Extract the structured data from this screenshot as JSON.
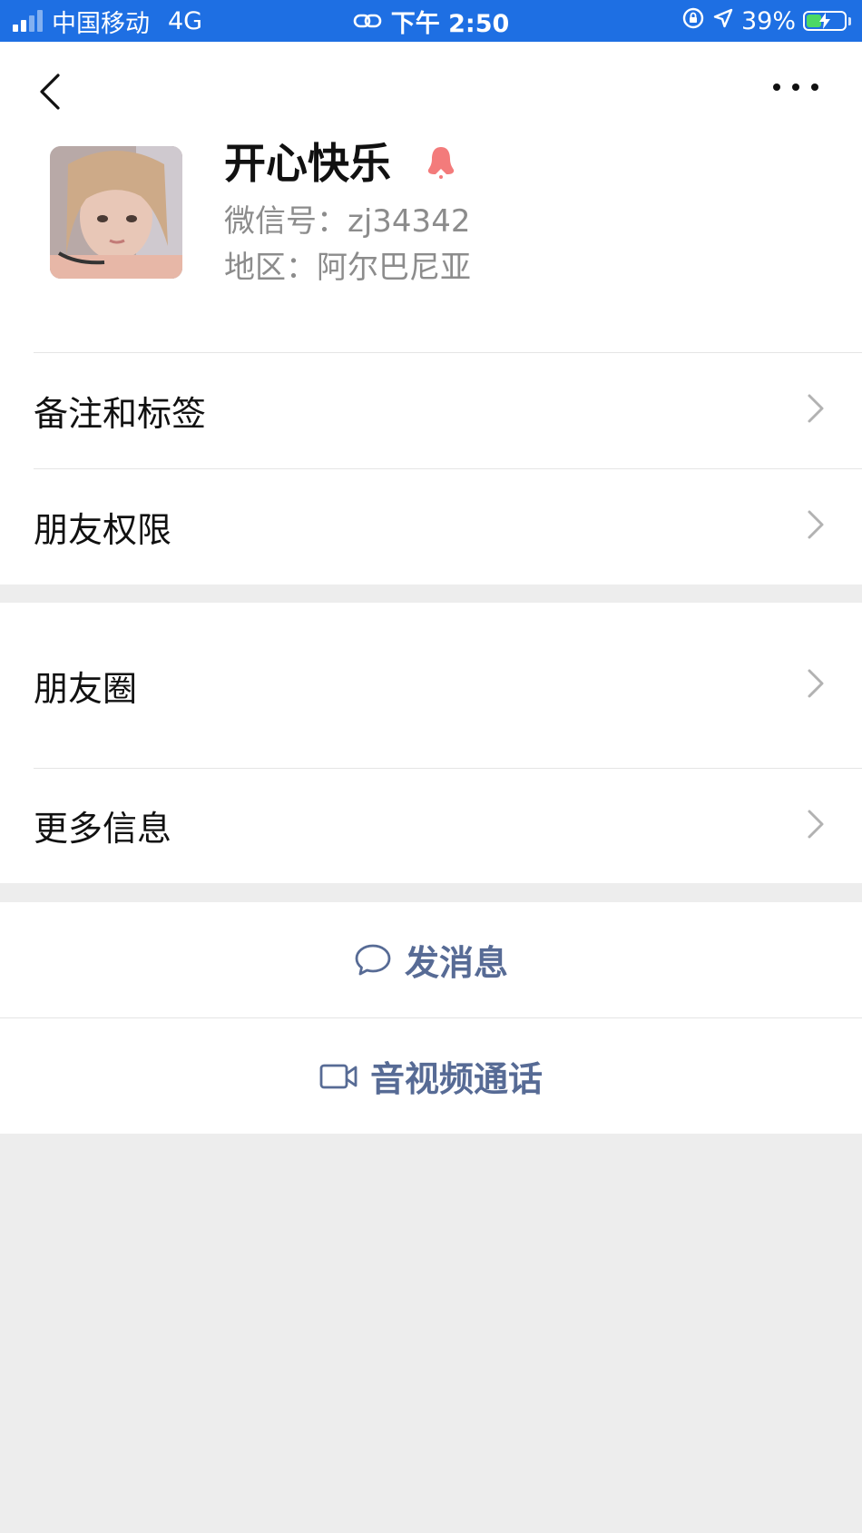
{
  "status_bar": {
    "carrier": "中国移动",
    "network": "4G",
    "time": "下午 2:50",
    "battery": "39%",
    "battery_level": 0.39,
    "battery_color": "#4cd964",
    "background": "#1e6fe3"
  },
  "nav": {
    "back_icon": "chevron-left-icon",
    "more_icon": "more-dots-icon"
  },
  "profile": {
    "nickname": "开心快乐",
    "gender_icon": "female-icon",
    "gender_color": "#f37b7b",
    "wechat_id": "微信号：zj34342",
    "region": "地区：阿尔巴尼亚"
  },
  "menu": {
    "remarks_tags": "备注和标签",
    "friend_permissions": "朋友权限",
    "moments": "朋友圈",
    "more_info": "更多信息"
  },
  "actions": {
    "send_message": "发消息",
    "av_call": "音视频通话",
    "accent_color": "#576b95"
  }
}
